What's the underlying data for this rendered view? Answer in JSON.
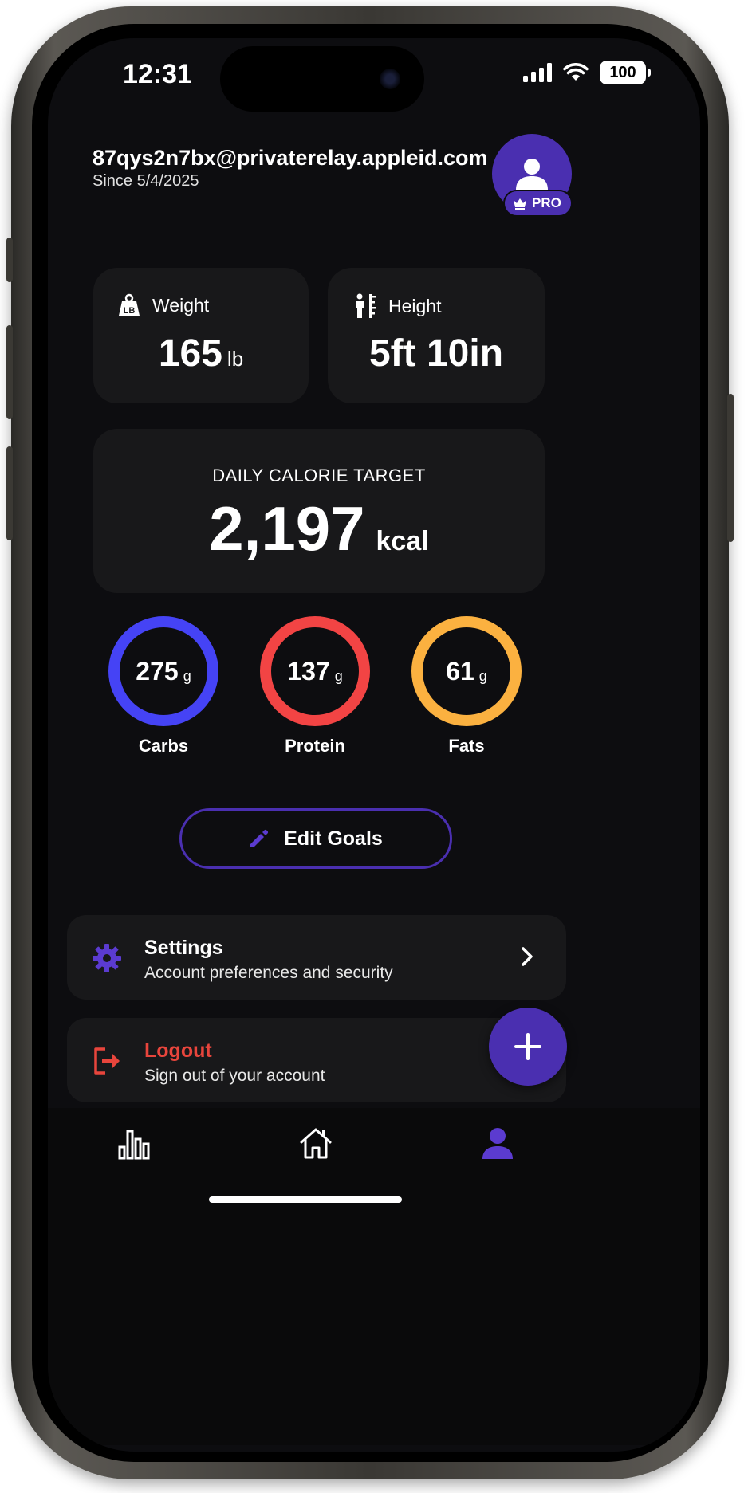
{
  "status_bar": {
    "time": "12:31",
    "battery": "100"
  },
  "profile": {
    "email": "87qys2n7bx@privaterelay.appleid.com",
    "since": "Since 5/4/2025",
    "badge": "PRO"
  },
  "stats": {
    "weight": {
      "label": "Weight",
      "value": "165",
      "unit": "lb"
    },
    "height": {
      "label": "Height",
      "value": "5ft 10in"
    }
  },
  "calorie": {
    "label": "DAILY CALORIE TARGET",
    "value": "2,197",
    "unit": "kcal"
  },
  "macros": [
    {
      "label": "Carbs",
      "value": "275",
      "unit": "g",
      "color": "#4543f5"
    },
    {
      "label": "Protein",
      "value": "137",
      "unit": "g",
      "color": "#f24444"
    },
    {
      "label": "Fats",
      "value": "61",
      "unit": "g",
      "color": "#fbb140"
    }
  ],
  "edit_goals": {
    "label": "Edit Goals"
  },
  "menu": {
    "settings": {
      "title": "Settings",
      "subtitle": "Account preferences and security"
    },
    "logout": {
      "title": "Logout",
      "subtitle": "Sign out of your account"
    }
  },
  "colors": {
    "accent": "#4a2fb0",
    "danger": "#e8453c",
    "card": "#18181a",
    "background": "#0d0d10"
  },
  "tabs": [
    {
      "icon": "bar-chart-icon",
      "active": false
    },
    {
      "icon": "home-icon",
      "active": false
    },
    {
      "icon": "profile-icon",
      "active": true
    }
  ]
}
